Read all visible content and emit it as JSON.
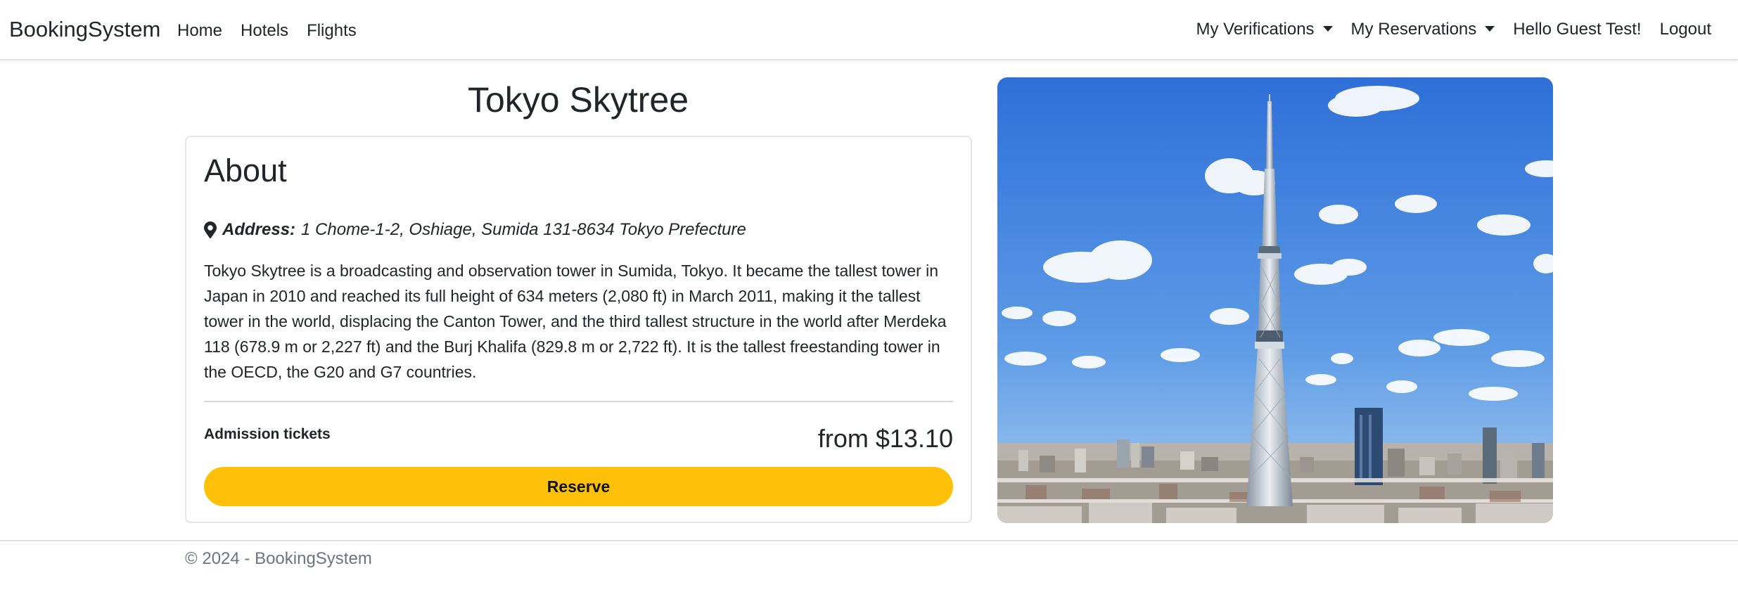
{
  "navbar": {
    "brand": "BookingSystem",
    "links": [
      "Home",
      "Hotels",
      "Flights"
    ],
    "verifications": "My Verifications",
    "reservations": "My Reservations",
    "greeting": "Hello Guest Test!",
    "logout": "Logout"
  },
  "attraction": {
    "title": "Tokyo Skytree",
    "about_heading": "About",
    "address_label": "Address:",
    "address_value": "1 Chome-1-2, Oshiage, Sumida 131-8634 Tokyo Prefecture",
    "description": "Tokyo Skytree is a broadcasting and observation tower in Sumida, Tokyo. It became the tallest tower in Japan in 2010 and reached its full height of 634 meters (2,080 ft) in March 2011, making it the tallest tower in the world, displacing the Canton Tower, and the third tallest structure in the world after Merdeka 118 (678.9 m or 2,227 ft) and the Burj Khalifa (829.8 m or 2,722 ft). It is the tallest freestanding tower in the OECD, the G20 and G7 countries.",
    "ticket_label": "Admission tickets",
    "price": "from $13.10",
    "reserve_label": "Reserve"
  },
  "footer": {
    "text": "© 2024 - BookingSystem"
  },
  "colors": {
    "reserve_button": "#ffc107",
    "sky_top": "#2e6fd8",
    "sky_bottom": "#8fc0ef",
    "footer_text": "#6c757d"
  },
  "icons": {
    "address": "map-marker-icon",
    "dropdown": "caret-down-icon"
  }
}
